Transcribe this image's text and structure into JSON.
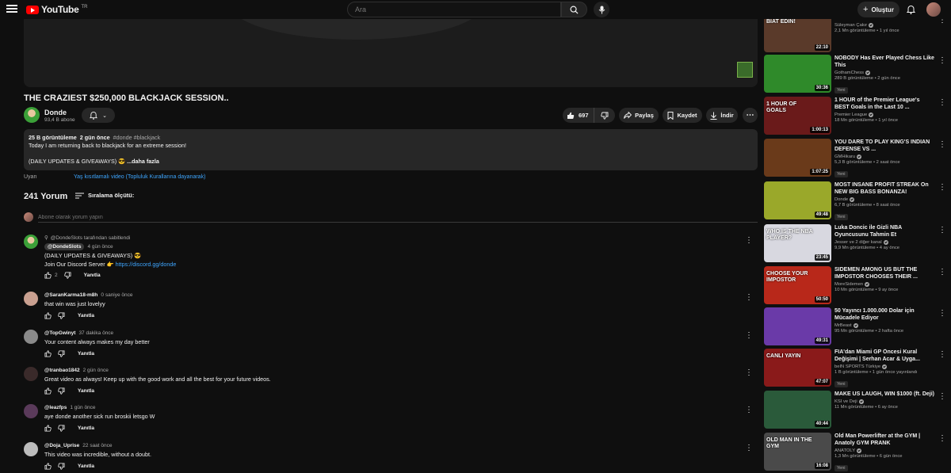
{
  "header": {
    "logo_text": "YouTube",
    "country": "TR",
    "search_placeholder": "Ara",
    "create_label": "Oluştur"
  },
  "video": {
    "title": "THE CRAZIEST $250,000 BLACKJACK SESSION..",
    "channel": "Donde",
    "subscribers": "93,4 B abone",
    "likes": "697",
    "share_label": "Paylaş",
    "save_label": "Kaydet",
    "download_label": "İndir"
  },
  "description": {
    "views": "25 B görüntüleme",
    "date": "2 gün önce",
    "tags": "#donde #blackjack",
    "line1": "Today I am returning back to blackjack for an extreme session!",
    "line2": "(DAILY UPDATES & GIVEAWAYS) 😎",
    "more": "...daha fazla"
  },
  "warning": {
    "label": "Uyarı",
    "link": "Yaş kısıtlamalı video (Topluluk Kurallarına dayanarak)"
  },
  "comments": {
    "count": "241 Yorum",
    "sort_label": "Sıralama ölçütü:",
    "add_placeholder": "Abone olarak yorum yapın",
    "reply_label": "Yanıtla",
    "pinned": {
      "pin_text": "@DondeSlots tarafından sabitlendi",
      "author": "@DondeSlots",
      "time": "4 gün önce",
      "line1": "(DAILY UPDATES & GIVEAWAYS) 😎",
      "line2": "Join Our Discord Server 👉",
      "link": "https://discord.gg/donde",
      "likes": "2"
    },
    "items": [
      {
        "author": "@SaranKarma18-m8h",
        "time": "0 saniye önce",
        "text": "that win was just lovelyy"
      },
      {
        "author": "@TopGwinyt",
        "time": "37 dakika önce",
        "text": "Your content always makes my day better"
      },
      {
        "author": "@tranbao1842",
        "time": "2 gün önce",
        "text": "Great video as always! Keep up with the good work and all the best for your future videos."
      },
      {
        "author": "@leazfps",
        "time": "1 gün önce",
        "text": "aye donde another sick run broskii letsgo W"
      },
      {
        "author": "@Doja_Uprise",
        "time": "22 saat önce",
        "text": "This video was incredible, without a doubt."
      }
    ]
  },
  "recommendations": [
    {
      "title": "Bölüm 1",
      "channel": "Süleyman Çakır",
      "meta": "2,1 Mn görüntüleme • 1 yıl önce",
      "duration": "22:10",
      "new": "",
      "thumb_color": "#5a3a2a",
      "thumb_text": "BİAT EDİN!"
    },
    {
      "title": "NOBODY Has Ever Played Chess Like This",
      "channel": "GothamChess",
      "meta": "289 B görüntüleme • 2 gün önce",
      "duration": "30:36",
      "new": "Yeni",
      "thumb_color": "#2f8a2a",
      "thumb_text": ""
    },
    {
      "title": "1 HOUR of the Premier League's BEST Goals in the Last 10 ...",
      "channel": "Premier League",
      "meta": "18 Mn görüntüleme • 1 yıl önce",
      "duration": "1:00:13",
      "new": "",
      "thumb_color": "#6a1a1a",
      "thumb_text": "1 HOUR OF GOALS"
    },
    {
      "title": "YOU DARE TO PLAY KING'S INDIAN DEFENSE VS ...",
      "channel": "GMHikaru",
      "meta": "5,3 B görüntüleme • 2 saat önce",
      "duration": "1:07:25",
      "new": "Yeni",
      "thumb_color": "#6a3a1a",
      "thumb_text": ""
    },
    {
      "title": "MOST INSANE PROFIT STREAK On NEW BIG BASS BONANZA!",
      "channel": "Donde",
      "meta": "6,7 B görüntüleme • 8 saat önce",
      "duration": "49:48",
      "new": "Yeni",
      "thumb_color": "#9aa82a",
      "thumb_text": ""
    },
    {
      "title": "Luka Doncic ile Gizli NBA Oyuncusunu Tahmin Et",
      "channel": "Jesser ve 2 diğer kanal",
      "meta": "9,9 Mn görüntüleme • 4 ay önce",
      "duration": "23:45",
      "new": "",
      "thumb_color": "#d8d8e0",
      "thumb_text": "WHO IS THE NBA PLAYER?"
    },
    {
      "title": "SIDEMEN AMONG US BUT THE IMPOSTOR CHOOSES THEIR ...",
      "channel": "MoreSidemen",
      "meta": "10 Mn görüntüleme • 9 ay önce",
      "duration": "50:50",
      "new": "",
      "thumb_color": "#b8281a",
      "thumb_text": "CHOOSE YOUR IMPOSTOR"
    },
    {
      "title": "50 Yayıncı 1.000.000 Dolar için Mücadele Ediyor",
      "channel": "MrBeast",
      "meta": "95 Mn görüntüleme • 2 hafta önce",
      "duration": "49:31",
      "new": "",
      "thumb_color": "#6a3aa8",
      "thumb_text": ""
    },
    {
      "title": "FIA'dan Miami GP Öncesi Kural Değişimi | Serhan Acar & Uyga...",
      "channel": "beIN SPORTS Türkiye",
      "meta": "1 B görüntüleme • 1 gün önce yayınlandı",
      "duration": "47:07",
      "new": "Yeni",
      "thumb_color": "#8a1a1a",
      "thumb_text": "CANLI YAYIN"
    },
    {
      "title": "MAKE US LAUGH, WIN $1000 (ft. Deji)",
      "channel": "KSI ve Deji",
      "meta": "11 Mn görüntüleme • 6 ay önce",
      "duration": "40:44",
      "new": "",
      "thumb_color": "#2a5a3a",
      "thumb_text": ""
    },
    {
      "title": "Old Man Powerlifter at the GYM | Anatoly GYM PRANK",
      "channel": "ANATOLY",
      "meta": "1,3 Mn görüntüleme • 6 gün önce",
      "duration": "16:08",
      "new": "Yeni",
      "thumb_color": "#4a4a4a",
      "thumb_text": "OLD MAN IN THE GYM"
    }
  ]
}
